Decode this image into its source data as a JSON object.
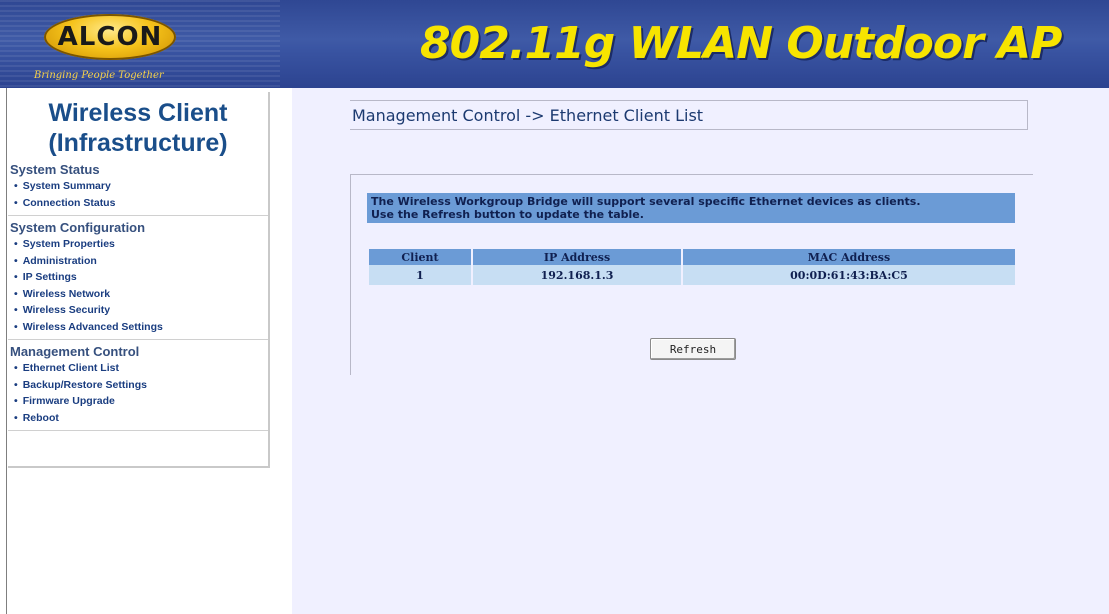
{
  "header": {
    "logo_text": "ALCON",
    "tagline": "Bringing People Together",
    "title": "802.11g WLAN Outdoor AP"
  },
  "sidebar": {
    "title_line1": "Wireless Client",
    "title_line2": "(Infrastructure)",
    "sections": [
      {
        "heading": "System Status",
        "items": [
          "System Summary",
          "Connection Status"
        ]
      },
      {
        "heading": "System Configuration",
        "items": [
          "System Properties",
          "Administration",
          "IP Settings",
          "Wireless Network",
          "Wireless Security",
          "Wireless Advanced Settings"
        ]
      },
      {
        "heading": "Management Control",
        "items": [
          "Ethernet Client List",
          "Backup/Restore Settings",
          "Firmware Upgrade",
          "Reboot"
        ]
      }
    ]
  },
  "main": {
    "page_heading": "Management Control -> Ethernet Client List",
    "info_line1": "The Wireless Workgroup Bridge will support several specific Ethernet devices as clients.",
    "info_line2": "Use the Refresh button to update the table.",
    "table": {
      "columns": [
        "Client",
        "IP Address",
        "MAC Address"
      ],
      "rows": [
        [
          "1",
          "192.168.1.3",
          "00:0D:61:43:BA:C5"
        ]
      ]
    },
    "refresh_label": "Refresh"
  },
  "colors": {
    "header_blue": "#3a55a3",
    "title_yellow": "#f7e400",
    "sidebar_title": "#1a4e8a",
    "content_bg": "#f0f0ff",
    "table_header": "#6b9bd6",
    "table_cell": "#c7def3"
  }
}
